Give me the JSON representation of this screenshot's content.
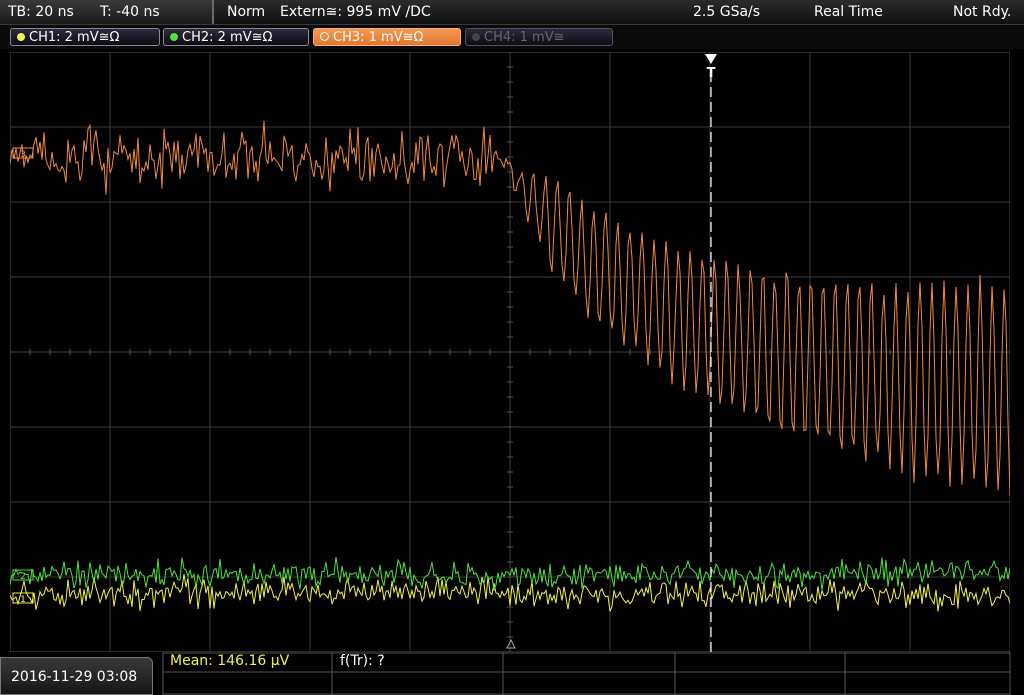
{
  "status": {
    "timebase": "TB: 20 ns",
    "trigger_time": "T: -40 ns",
    "mode": "Norm",
    "trigger_source": "Extern≅: 995 mV ∕DC",
    "sample_rate": "2.5 GSa/s",
    "acq_mode": "Real Time",
    "run_state": "Not Rdy."
  },
  "channels": [
    {
      "label": "CH1: 2 mV≅Ω",
      "color": "#f2f24a",
      "active": true
    },
    {
      "label": "CH2: 2 mV≅Ω",
      "color": "#50e040",
      "active": true
    },
    {
      "label": "CH3: 1 mV≅Ω",
      "color": "#f08a40",
      "active": true,
      "selected": true
    },
    {
      "label": "CH4: 1 mV≅",
      "color": "#666666",
      "active": false
    }
  ],
  "markers": {
    "trigger": "T",
    "ch1": "1",
    "ch2": "2",
    "ch3": "3"
  },
  "footer": {
    "datetime": "2016-11-29 03:08",
    "measurement1": "Mean: 146.16 µV",
    "measurement2": "f(Tr): ?"
  },
  "colors": {
    "ch1": "#f2f24a",
    "ch2": "#50e040",
    "ch3": "#f08a40",
    "grid": "#3a3a3a",
    "selected_chan_bg": "#f08a40"
  }
}
